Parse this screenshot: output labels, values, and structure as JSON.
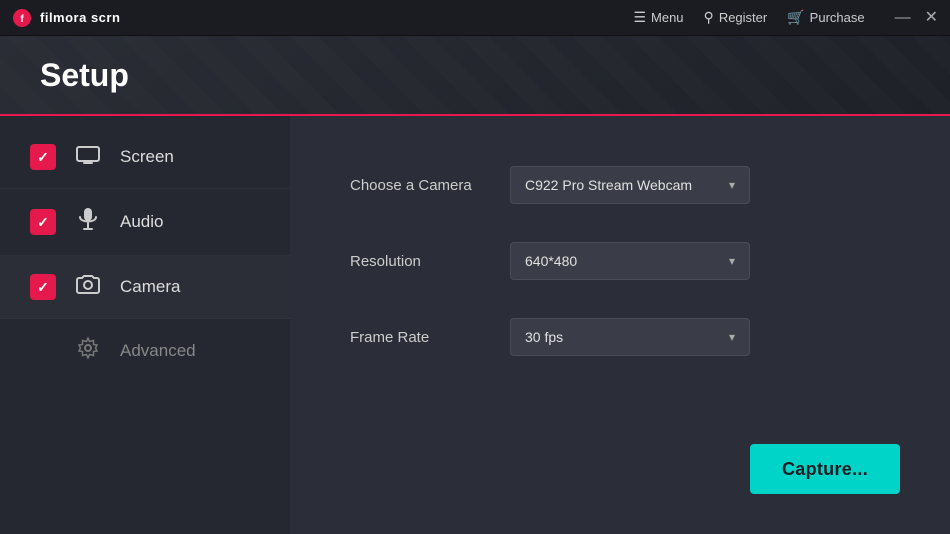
{
  "app": {
    "logo_text": "filmora scrn",
    "title_bar": {
      "menu_label": "Menu",
      "register_label": "Register",
      "purchase_label": "Purchase",
      "minimize_label": "—",
      "close_label": "✕"
    }
  },
  "header": {
    "title": "Setup"
  },
  "sidebar": {
    "items": [
      {
        "id": "screen",
        "label": "Screen",
        "checked": true
      },
      {
        "id": "audio",
        "label": "Audio",
        "checked": true
      },
      {
        "id": "camera",
        "label": "Camera",
        "checked": true
      }
    ],
    "advanced": {
      "label": "Advanced"
    }
  },
  "settings": {
    "rows": [
      {
        "id": "camera",
        "label": "Choose a Camera",
        "value": "C922 Pro Stream Webcam"
      },
      {
        "id": "resolution",
        "label": "Resolution",
        "value": "640*480"
      },
      {
        "id": "framerate",
        "label": "Frame Rate",
        "value": "30 fps"
      }
    ],
    "capture_button": "Capture..."
  },
  "colors": {
    "accent_red": "#e5194b",
    "accent_cyan": "#00d4c8",
    "checkbox_bg": "#e5194b"
  }
}
